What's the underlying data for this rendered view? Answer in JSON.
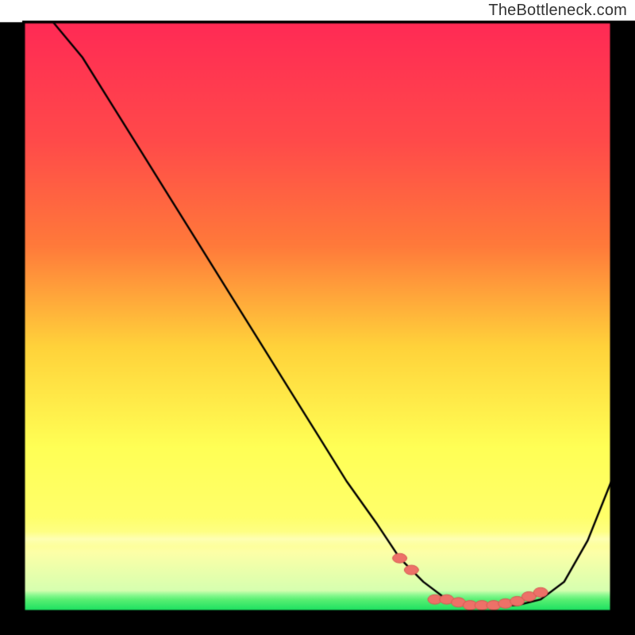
{
  "watermark": "TheBottleneck.com",
  "colors": {
    "frame": "#000000",
    "curve": "#000000",
    "gradient_top": "#ff2a55",
    "gradient_mid_upper": "#ff7a3a",
    "gradient_mid": "#ffd23a",
    "gradient_mid_lower": "#ffff6a",
    "gradient_lower": "#fdffa7",
    "gradient_bottom": "#15e05f",
    "dot_fill": "#ed7168",
    "dot_stroke": "#d55a52"
  },
  "chart_data": {
    "type": "line",
    "title": "",
    "xlabel": "",
    "ylabel": "",
    "xlim": [
      0,
      100
    ],
    "ylim": [
      0,
      100
    ],
    "series": [
      {
        "name": "bottleneck-curve",
        "x": [
          5,
          10,
          15,
          20,
          25,
          30,
          35,
          40,
          45,
          50,
          55,
          60,
          64,
          68,
          72,
          76,
          80,
          84,
          88,
          92,
          96,
          100
        ],
        "y": [
          100,
          94,
          86,
          78,
          70,
          62,
          54,
          46,
          38,
          30,
          22,
          15,
          9,
          5,
          2,
          1,
          1,
          1,
          2,
          5,
          12,
          22
        ]
      }
    ],
    "markers": {
      "name": "emphasis-dots",
      "x": [
        64,
        66,
        70,
        72,
        74,
        76,
        78,
        80,
        82,
        84,
        86,
        88
      ],
      "y": [
        9,
        7,
        2,
        2,
        1.5,
        1,
        1,
        1,
        1.3,
        1.7,
        2.5,
        3.2
      ]
    },
    "annotation_bands": [
      {
        "y0": 11,
        "y1": 13.5,
        "color": "#fdffa7"
      },
      {
        "y0": 0,
        "y1": 3.5,
        "color": "#15e05f"
      }
    ]
  }
}
